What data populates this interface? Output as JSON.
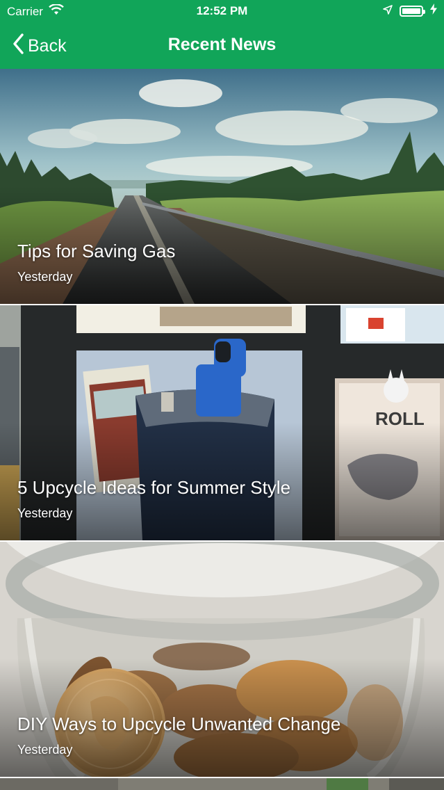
{
  "status_bar": {
    "carrier": "Carrier",
    "time": "12:52 PM"
  },
  "nav": {
    "back_label": "Back",
    "title": "Recent News"
  },
  "colors": {
    "brand_green": "#11a559"
  },
  "articles": [
    {
      "title": "Tips for Saving Gas",
      "date": "Yesterday"
    },
    {
      "title": "5 Upcycle Ideas for Summer Style",
      "date": "Yesterday"
    },
    {
      "title": "DIY Ways to Upcycle Unwanted Change",
      "date": "Yesterday"
    }
  ]
}
